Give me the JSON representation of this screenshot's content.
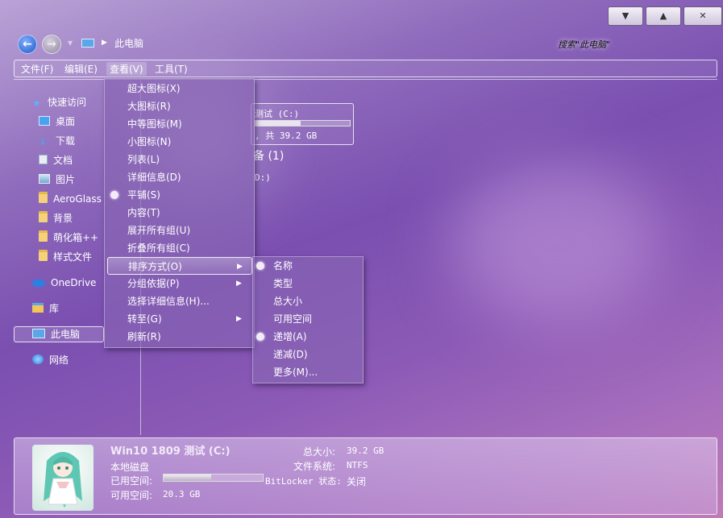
{
  "window": {
    "minimize_icon": "chevron-down",
    "maximize_icon": "chevron-up",
    "close_icon": "x"
  },
  "address": {
    "location": "此电脑",
    "search_placeholder": "搜索\"此电脑\""
  },
  "menubar": {
    "file": "文件(F)",
    "edit": "编辑(E)",
    "view": "查看(V)",
    "tools": "工具(T)"
  },
  "sidebar": {
    "quick_access": "快速访问",
    "items": [
      "桌面",
      "下载",
      "文档",
      "图片",
      "AeroGlass",
      "背景",
      "萌化箱++",
      "样式文件"
    ],
    "onedrive": "OneDrive",
    "library": "库",
    "this_pc": "此电脑",
    "network": "网络"
  },
  "main": {
    "drive_label_fragment": "测试 (C:)",
    "drive_space_fragment": ", 共 39.2 GB",
    "devices_group_fragment": "备 (1)",
    "second_drive_fragment": "D:)",
    "drive_used_fraction": 0.48
  },
  "view_menu": {
    "items": [
      {
        "label": "超大图标(X)"
      },
      {
        "label": "大图标(R)"
      },
      {
        "label": "中等图标(M)"
      },
      {
        "label": "小图标(N)"
      },
      {
        "label": "列表(L)"
      },
      {
        "label": "详细信息(D)"
      },
      {
        "label": "平铺(S)",
        "selected": true
      },
      {
        "label": "内容(T)"
      },
      {
        "label": "展开所有组(U)"
      },
      {
        "label": "折叠所有组(C)"
      },
      {
        "label": "排序方式(O)",
        "submenu": true,
        "highlighted": true
      },
      {
        "label": "分组依据(P)",
        "submenu": true
      },
      {
        "label": "选择详细信息(H)..."
      },
      {
        "label": "转至(G)",
        "submenu": true
      },
      {
        "label": "刷新(R)"
      }
    ]
  },
  "sort_menu": {
    "items": [
      {
        "label": "名称",
        "selected": true
      },
      {
        "label": "类型"
      },
      {
        "label": "总大小"
      },
      {
        "label": "可用空间"
      },
      {
        "label": "递增(A)",
        "selected": true
      },
      {
        "label": "递减(D)"
      },
      {
        "label": "更多(M)..."
      }
    ]
  },
  "details": {
    "name": "Win10 1809 测试 (C:)",
    "type": "本地磁盘",
    "used_label": "已用空间:",
    "free_label": "可用空间:",
    "free_value": "20.3 GB",
    "used_fraction": 0.48,
    "total_label": "总大小:",
    "total_value": "39.2 GB",
    "fs_label": "文件系统:",
    "fs_value": "NTFS",
    "bitlocker_label": "BitLocker 状态:",
    "bitlocker_value": "关闭"
  },
  "colors": {
    "accent": "#8a62b8",
    "menu_bg": "#8764b4"
  }
}
